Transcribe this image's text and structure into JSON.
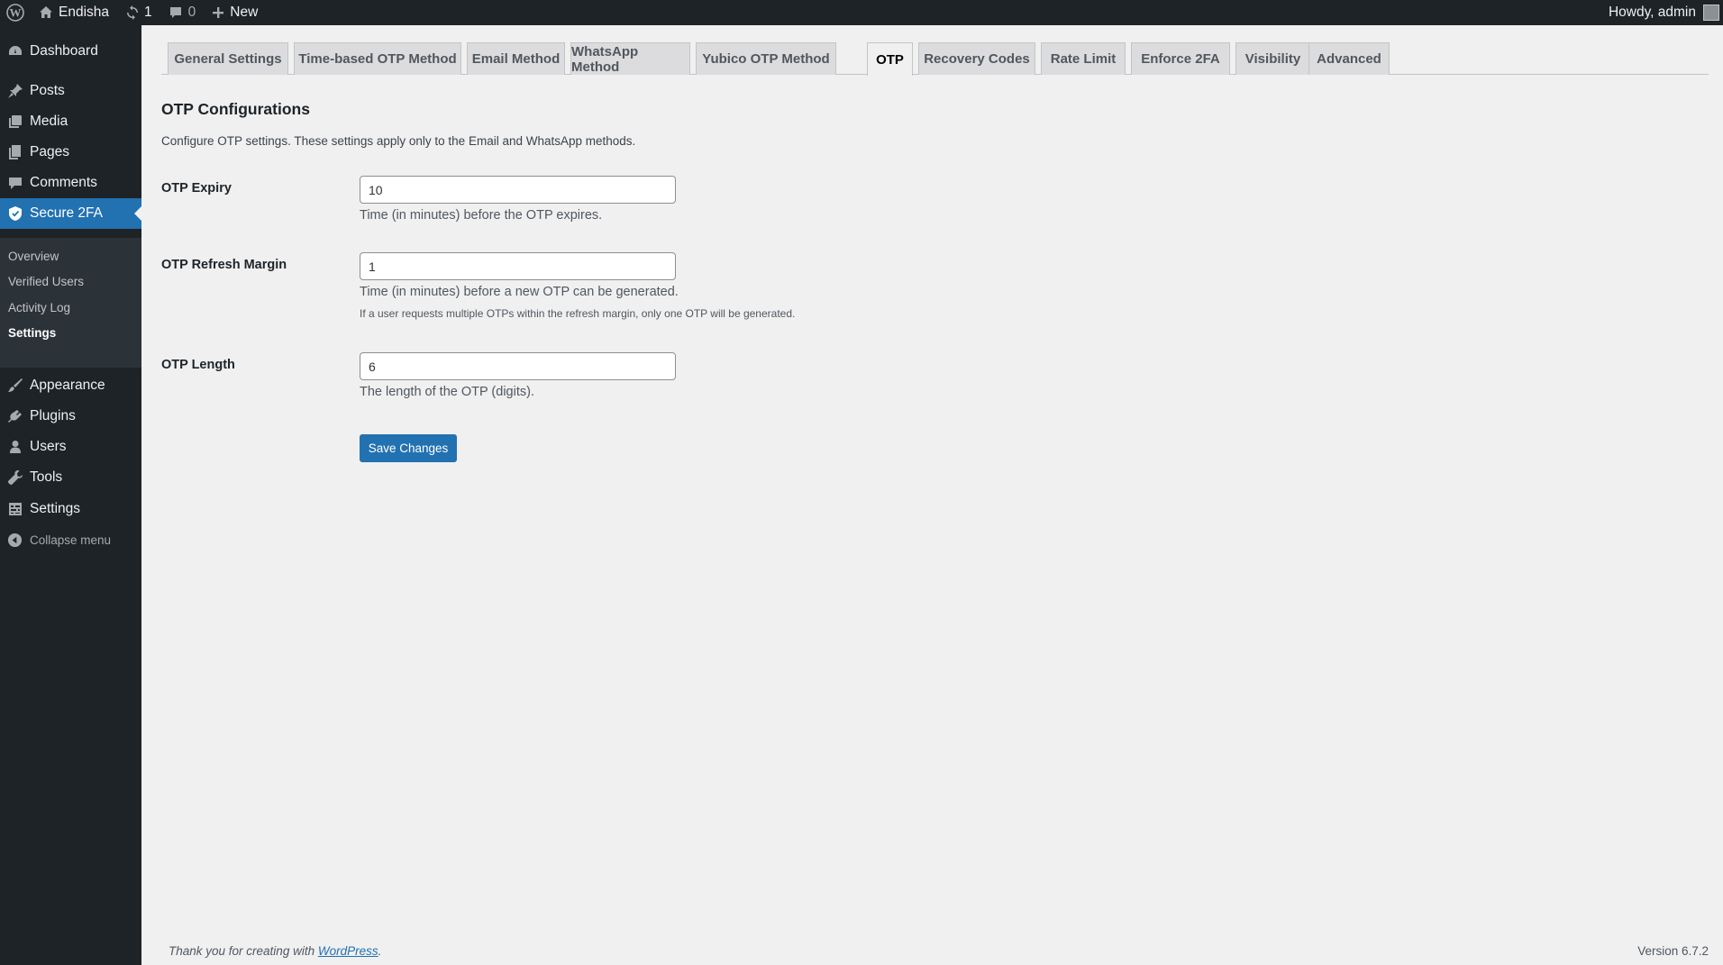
{
  "adminbar": {
    "wp_logo_icon": "wordpress-icon",
    "site_name": "Endisha",
    "updates_count": "1",
    "comments_count": "0",
    "new_label": "New",
    "howdy": "Howdy, admin"
  },
  "sidebar": {
    "items": [
      {
        "label": "Dashboard",
        "icon": "dashboard-icon"
      },
      {
        "label": "Posts",
        "icon": "pin-icon"
      },
      {
        "label": "Media",
        "icon": "media-icon"
      },
      {
        "label": "Pages",
        "icon": "pages-icon"
      },
      {
        "label": "Comments",
        "icon": "comment-icon"
      },
      {
        "label": "Secure 2FA",
        "icon": "shield-icon"
      },
      {
        "label": "Appearance",
        "icon": "brush-icon"
      },
      {
        "label": "Plugins",
        "icon": "plug-icon"
      },
      {
        "label": "Users",
        "icon": "user-icon"
      },
      {
        "label": "Tools",
        "icon": "wrench-icon"
      },
      {
        "label": "Settings",
        "icon": "settings-icon"
      }
    ],
    "submenu": [
      "Overview",
      "Verified Users",
      "Activity Log",
      "Settings"
    ],
    "collapse_label": "Collapse menu"
  },
  "tabs": [
    "General Settings",
    "Time-based OTP Method",
    "Email Method",
    "WhatsApp Method",
    "Yubico OTP Method",
    "OTP",
    "Recovery Codes",
    "Rate Limit",
    "Enforce 2FA",
    "Visibility",
    "Advanced"
  ],
  "active_tab": "OTP",
  "main": {
    "heading": "OTP Configurations",
    "intro": "Configure OTP settings. These settings apply only to the Email and WhatsApp methods.",
    "fields": [
      {
        "label": "OTP Expiry",
        "value": "10",
        "description": "Time (in minutes) before the OTP expires."
      },
      {
        "label": "OTP Refresh Margin",
        "value": "1",
        "description": "Time (in minutes) before a new OTP can be generated.",
        "note": "If a user requests multiple OTPs within the refresh margin, only one OTP will be generated."
      },
      {
        "label": "OTP Length",
        "value": "6",
        "description": "The length of the OTP (digits)."
      }
    ],
    "save_label": "Save Changes"
  },
  "footer": {
    "thanks_prefix": "Thank you for creating with ",
    "thanks_link": "WordPress",
    "thanks_suffix": ".",
    "version": "Version 6.7.2"
  },
  "colors": {
    "accent": "#2271b1",
    "adminbar": "#1d2327",
    "background": "#f0f0f1"
  }
}
